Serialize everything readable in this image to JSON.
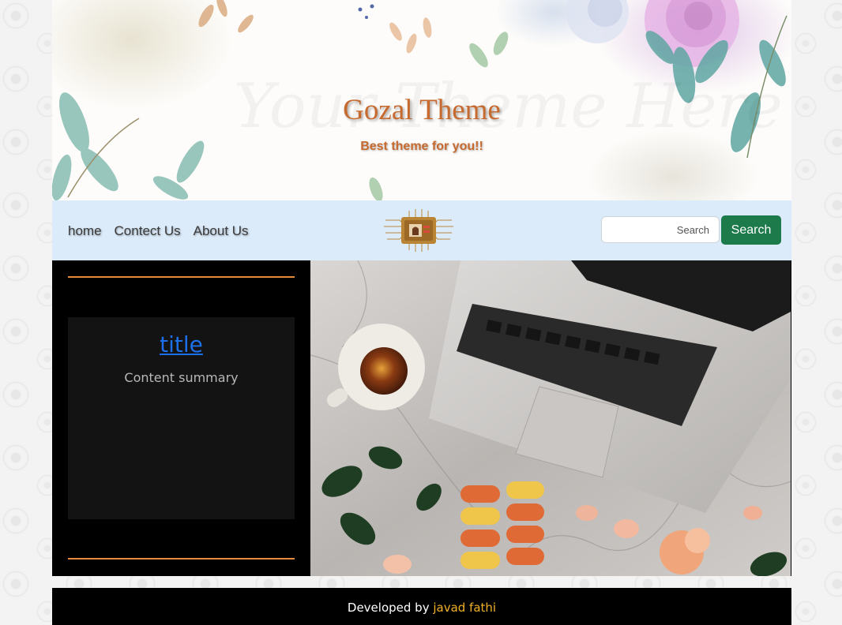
{
  "header": {
    "title": "Gozal Theme",
    "subtitle": "Best theme for you!!"
  },
  "nav": {
    "items": [
      {
        "label": "home"
      },
      {
        "label": "Contect Us"
      },
      {
        "label": "About Us"
      }
    ],
    "search_placeholder": "Search",
    "search_button": "Search"
  },
  "card": {
    "title": "title",
    "summary": "Content summary"
  },
  "footer": {
    "prefix": "Developed by ",
    "author": "javad fathi"
  },
  "colors": {
    "brand": "#c66a2f",
    "navbar_bg": "#dcebfa",
    "search_button": "#1d7a4a",
    "accent_rule": "#e88a3c",
    "link": "#1c6fe8",
    "footer_link": "#f0b028"
  }
}
